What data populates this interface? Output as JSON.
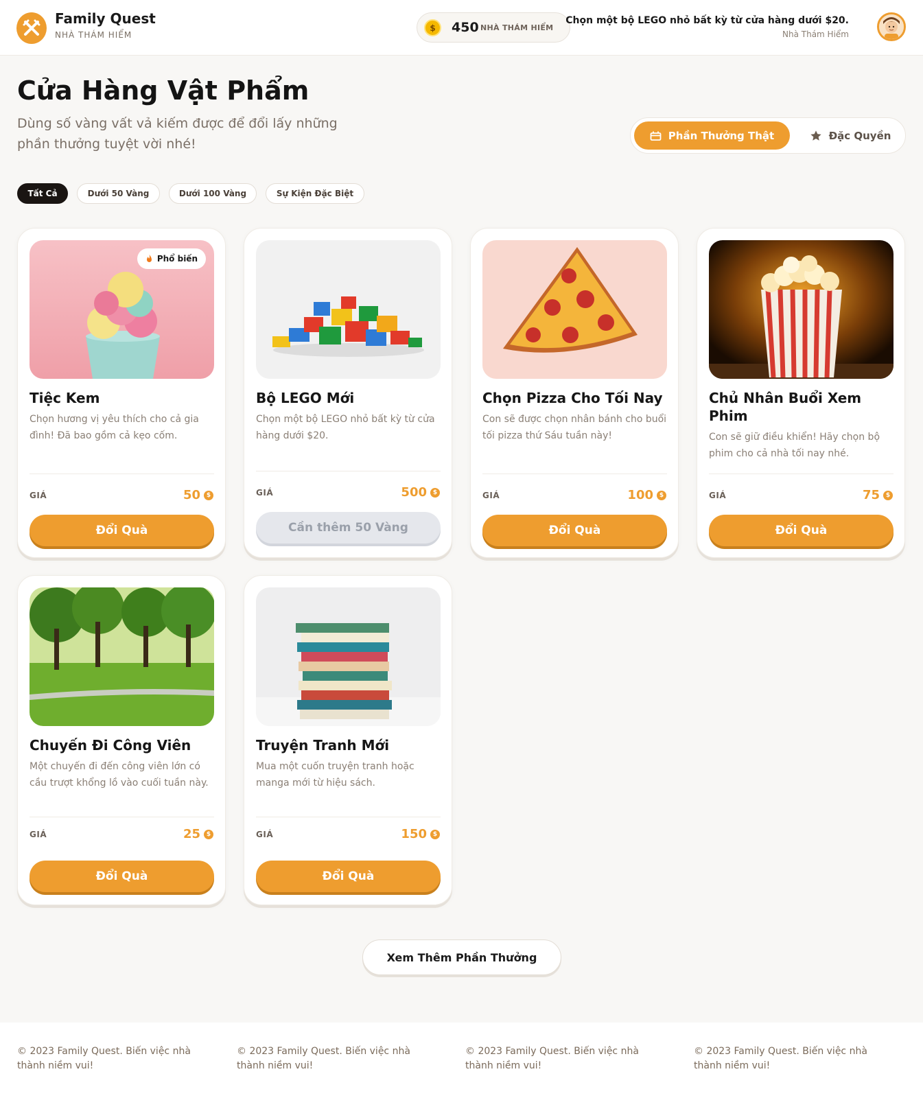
{
  "header": {
    "app_name": "Family Quest",
    "app_sub": "NHÀ THÁM HIỂM",
    "coin_amount": "450",
    "coin_unit": "NHÀ THÁM HIỂM",
    "coin_symbol": "$",
    "message": "Chọn một bộ LEGO nhỏ bất kỳ từ cửa hàng dưới $20.",
    "role": "Nhà Thám Hiểm"
  },
  "page": {
    "title": "Cửa Hàng Vật Phẩm",
    "description": "Dùng số vàng vất vả kiếm được để đổi lấy những phần thưởng tuyệt vời nhé!"
  },
  "segments": {
    "active": "Phần Thưởng Thật",
    "other": "Đặc Quyền"
  },
  "filters": [
    "Tất Cả",
    "Dưới 50 Vàng",
    "Dưới 100 Vàng",
    "Sự Kiện Đặc Biệt"
  ],
  "price_label": "GIÁ",
  "redeem_label": "Đổi Quà",
  "popular_badge": "Phổ biến",
  "colors": {
    "accent": "#ee9d2f",
    "dark": "#1a1512",
    "disabled": "#e5e7ec"
  },
  "rewards": [
    {
      "title": "Tiệc Kem",
      "description": "Chọn hương vị yêu thích cho cả gia đình! Đã bao gồm cả kẹo cốm.",
      "price": "50",
      "button": "Đổi Quà",
      "image_icon": "ice-cream"
    },
    {
      "title": "Bộ LEGO Mới",
      "description": "Chọn một bộ LEGO nhỏ bất kỳ từ cửa hàng dưới $20.",
      "price": "500",
      "button": "Cần thêm 50 Vàng",
      "image_icon": "lego-bricks"
    },
    {
      "title": "Chọn Pizza Cho Tối Nay",
      "description": "Con sẽ được chọn nhân bánh cho buổi tối pizza thứ Sáu tuần này!",
      "price": "100",
      "button": "Đổi Quà",
      "image_icon": "pizza"
    },
    {
      "title": "Chủ Nhân Buổi Xem Phim",
      "description": "Con sẽ giữ điều khiển! Hãy chọn bộ phim cho cả nhà tối nay nhé.",
      "price": "75",
      "button": "Đổi Quà",
      "image_icon": "popcorn"
    },
    {
      "title": "Chuyến Đi Công Viên",
      "description": "Một chuyến đi đến công viên lớn có cầu trượt khổng lồ vào cuối tuần này.",
      "price": "25",
      "button": "Đổi Quà",
      "image_icon": "park"
    },
    {
      "title": "Truyện Tranh Mới",
      "description": "Mua một cuốn truyện tranh hoặc manga mới từ hiệu sách.",
      "price": "150",
      "button": "Đổi Quà",
      "image_icon": "book-stack"
    }
  ],
  "more_button": "Xem Thêm Phần Thưởng",
  "footer_text": "© 2023 Family Quest. Biến việc nhà thành niềm vui!"
}
